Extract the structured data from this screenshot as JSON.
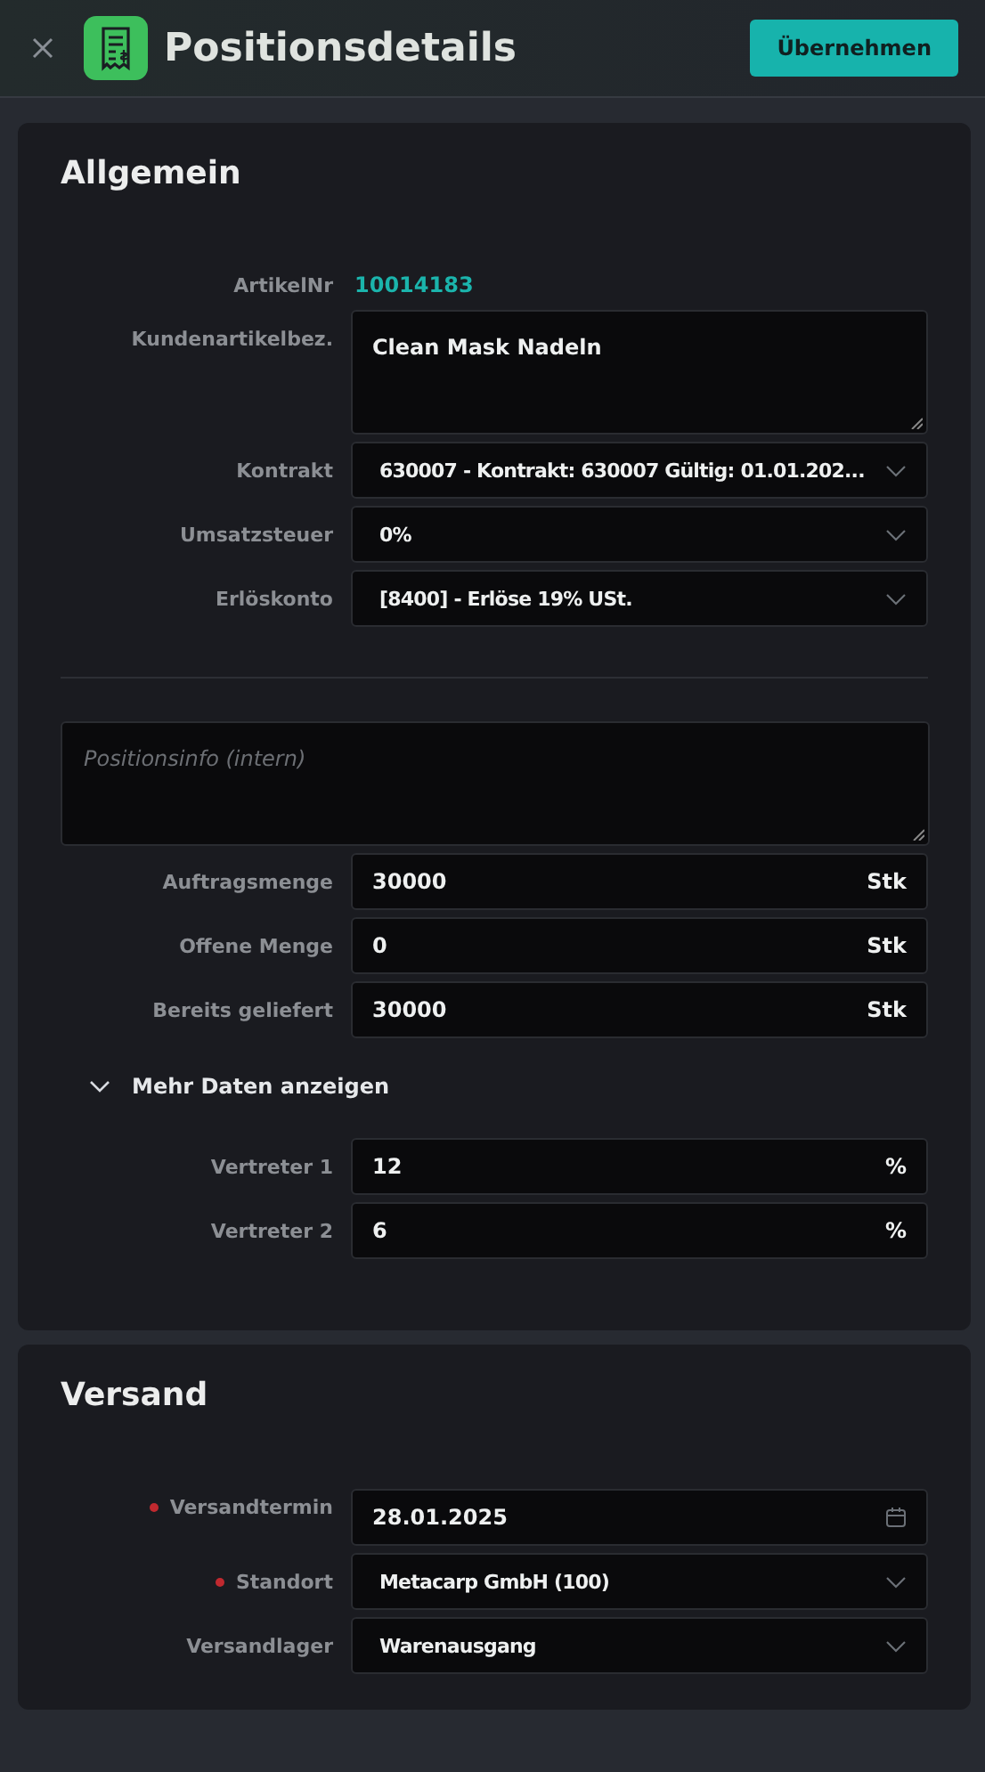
{
  "header": {
    "title": "Positionsdetails",
    "button": "Übernehmen"
  },
  "sections": [
    {
      "title": "Allgemein",
      "items": [
        {
          "kind": "link",
          "label": "ArtikelNr",
          "value": "10014183"
        },
        {
          "kind": "textarea",
          "label": "Kundenartikelbez.",
          "value": "Clean Mask Nadeln"
        },
        {
          "kind": "select",
          "label": "Kontrakt",
          "value": "630007 - Kontrakt: 630007 Gültig: 01.01.202..."
        },
        {
          "kind": "select",
          "label": "Umsatzsteuer",
          "value": "0%"
        },
        {
          "kind": "select",
          "label": "Erlöskonto",
          "value": "[8400] - Erlöse 19% USt."
        },
        {
          "kind": "note",
          "placeholder": "Positionsinfo (intern)"
        },
        {
          "kind": "unit",
          "label": "Auftragsmenge",
          "value": "30000",
          "unit": "Stk"
        },
        {
          "kind": "unit",
          "label": "Offene Menge",
          "value": "0",
          "unit": "Stk"
        },
        {
          "kind": "unit",
          "label": "Bereits geliefert",
          "value": "30000",
          "unit": "Stk"
        },
        {
          "kind": "toggle",
          "label": "Mehr Daten anzeigen",
          "expanded": true
        },
        {
          "kind": "unit",
          "label": "Vertreter 1",
          "value": "12",
          "unit": "%"
        },
        {
          "kind": "unit",
          "label": "Vertreter 2",
          "value": "6",
          "unit": "%"
        }
      ]
    },
    {
      "title": "Versand",
      "items": [
        {
          "kind": "date",
          "label": "Versandtermin",
          "value": "28.01.2025",
          "required": true
        },
        {
          "kind": "select",
          "label": "Standort",
          "value": "Metacarp GmbH (100)",
          "required": true
        },
        {
          "kind": "select",
          "label": "Versandlager",
          "value": "Warenausgang",
          "required": false
        }
      ]
    }
  ]
}
